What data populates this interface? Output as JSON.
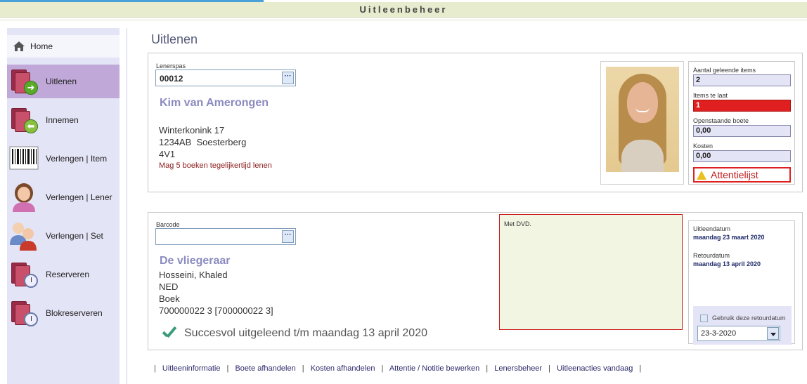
{
  "app": {
    "title": "Uitleenbeheer"
  },
  "sidebar": {
    "home": "Home",
    "items": [
      {
        "label": "Uitlenen",
        "icon": "books-arrow-right-icon",
        "active": true
      },
      {
        "label": "Innemen",
        "icon": "books-arrow-left-icon",
        "active": false
      },
      {
        "label": "Verlengen | Item",
        "icon": "barcode-icon",
        "active": false
      },
      {
        "label": "Verlengen | Lener",
        "icon": "person-icon",
        "active": false
      },
      {
        "label": "Verlengen | Set",
        "icon": "people-icon",
        "active": false
      },
      {
        "label": "Reserveren",
        "icon": "books-clock-icon",
        "active": false
      },
      {
        "label": "Blokreserveren",
        "icon": "books-clock-icon",
        "active": false
      }
    ]
  },
  "page": {
    "title": "Uitlenen"
  },
  "borrower": {
    "pass_label": "Lenerspas",
    "pass_value": "00012",
    "name": "Kim van Amerongen",
    "address_line1": "Winterkonink 17",
    "address_line2": "1234AB  Soesterberg",
    "group": "4V1",
    "limit_note": "Mag 5 boeken tegelijkertijd lenen"
  },
  "stats": {
    "borrowed_label": "Aantal geleende items",
    "borrowed_value": "2",
    "late_label": "Items te laat",
    "late_value": "1",
    "fine_label": "Openstaande boete",
    "fine_value": "0,00",
    "costs_label": "Kosten",
    "costs_value": "0,00",
    "attention": "Attentielijst"
  },
  "item": {
    "barcode_label": "Barcode",
    "barcode_value": "",
    "title": "De vliegeraar",
    "author": "Hosseini, Khaled",
    "language": "NED",
    "type": "Boek",
    "code": "700000022 3 [700000022 3]",
    "note": "Met DVD."
  },
  "dates": {
    "loan_label": "Uitleendatum",
    "loan_value": "maandag 23 maart 2020",
    "return_label": "Retourdatum",
    "return_value": "maandag 13 april 2020",
    "use_return_label": "Gebruik deze retourdatum",
    "return_select": "23-3-2020"
  },
  "status": {
    "message": "Succesvol uitgeleend t/m maandag 13 april 2020"
  },
  "footer": {
    "links": [
      "Uitleeninformatie",
      "Boete afhandelen",
      "Kosten afhandelen",
      "Attentie / Notitie bewerken",
      "Lenersbeheer",
      "Uitleenacties vandaag"
    ]
  },
  "colors": {
    "accent": "#c0a8d8",
    "danger": "#e02020",
    "name": "#8a8ac0",
    "success": "#3a9a7a"
  }
}
